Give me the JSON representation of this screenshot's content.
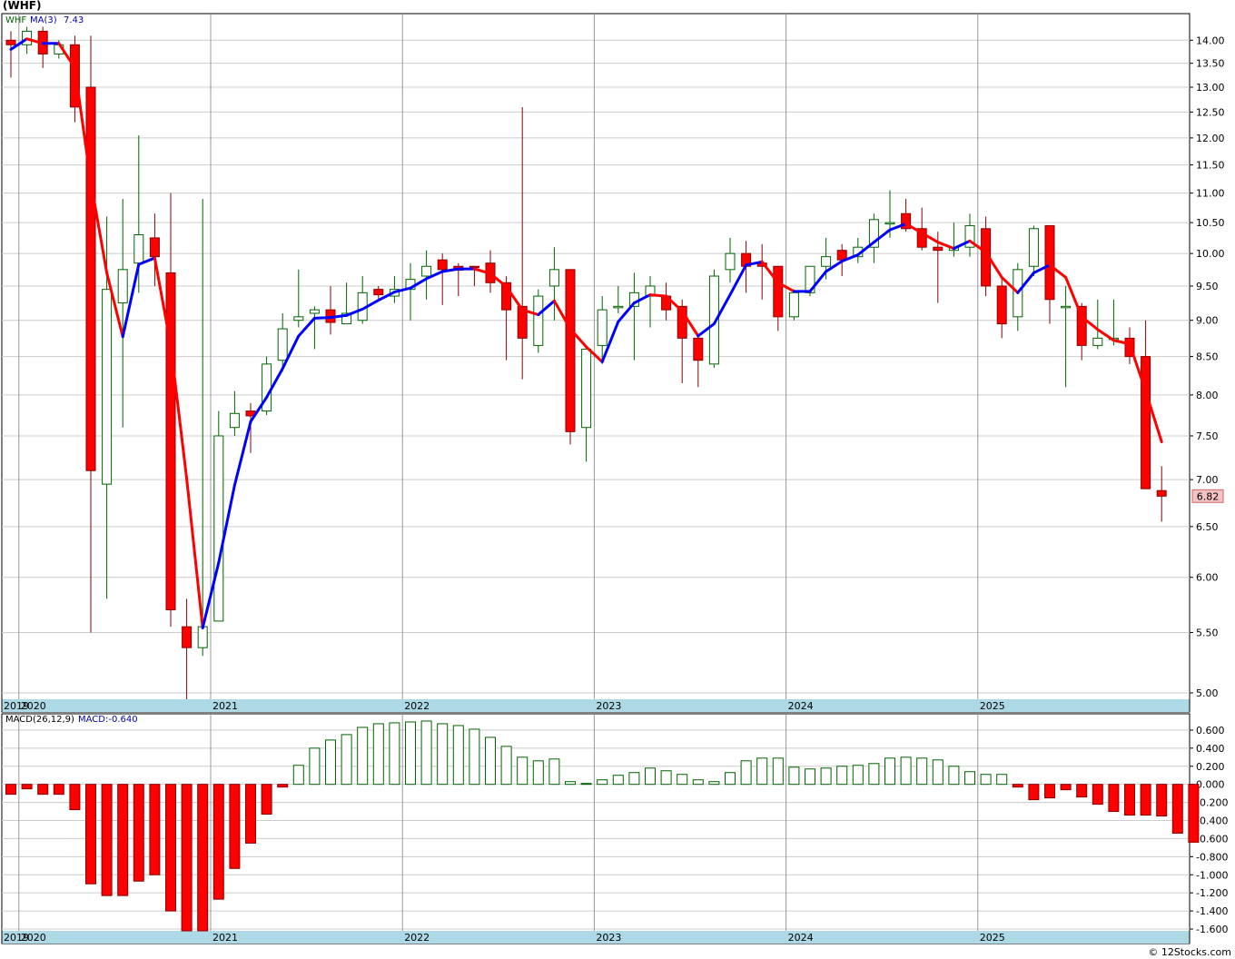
{
  "symbol_header": "(WHF)",
  "credit": "© 12Stocks.com",
  "colors": {
    "up": "#006400",
    "down": "#ff0000",
    "ma_up": "#0000ff",
    "ma_down": "#ff0000",
    "axis_band": "#add8e6",
    "grid": "#cccccc",
    "grid_v": "#999999"
  },
  "chart_data": {
    "type": "candlestick",
    "title": "(WHF)",
    "frequency": "monthly",
    "price_scale": "log",
    "price_ylim": [
      4.95,
      14.6
    ],
    "price_ticks": [
      "14.00",
      "13.50",
      "13.00",
      "12.50",
      "12.00",
      "11.50",
      "11.00",
      "10.50",
      "10.00",
      "9.50",
      "9.00",
      "8.50",
      "8.00",
      "7.50",
      "7.00",
      "6.50",
      "6.00",
      "5.50",
      "5.00"
    ],
    "year_labels": [
      "2019",
      "2020",
      "2021",
      "2022",
      "2023",
      "2024",
      "2025"
    ],
    "legend": {
      "symbol": "WHF",
      "ma_label": "MA(3)",
      "ma_value": "7.43"
    },
    "last_price_label": "6.82",
    "start": "2019-12",
    "ohlc": [
      [
        14.0,
        14.2,
        13.2,
        13.9
      ],
      [
        13.9,
        14.3,
        13.7,
        14.2
      ],
      [
        14.2,
        14.3,
        13.4,
        13.7
      ],
      [
        13.7,
        14.0,
        13.6,
        13.9
      ],
      [
        13.9,
        14.1,
        12.3,
        12.6
      ],
      [
        13.0,
        14.1,
        5.5,
        7.1
      ],
      [
        6.95,
        10.6,
        5.8,
        9.45
      ],
      [
        9.25,
        10.9,
        7.6,
        9.75
      ],
      [
        9.85,
        12.05,
        9.4,
        10.3
      ],
      [
        10.25,
        10.65,
        9.5,
        9.95
      ],
      [
        9.7,
        11.0,
        5.55,
        5.7
      ],
      [
        5.55,
        5.8,
        4.95,
        5.37
      ],
      [
        5.37,
        10.9,
        5.3,
        5.55
      ],
      [
        5.6,
        7.8,
        5.6,
        7.5
      ],
      [
        7.6,
        8.05,
        7.5,
        7.77
      ],
      [
        7.8,
        7.9,
        7.3,
        7.74
      ],
      [
        7.8,
        8.5,
        7.75,
        8.4
      ],
      [
        8.45,
        9.1,
        8.3,
        8.88
      ],
      [
        9.0,
        9.75,
        8.9,
        9.05
      ],
      [
        9.1,
        9.2,
        8.6,
        9.15
      ],
      [
        9.15,
        9.5,
        8.8,
        8.97
      ],
      [
        8.95,
        9.55,
        8.95,
        9.1
      ],
      [
        9.0,
        9.65,
        8.95,
        9.4
      ],
      [
        9.45,
        9.5,
        9.3,
        9.37
      ],
      [
        9.35,
        9.65,
        9.25,
        9.45
      ],
      [
        9.45,
        9.85,
        9.0,
        9.6
      ],
      [
        9.65,
        10.05,
        9.3,
        9.8
      ],
      [
        9.9,
        10.0,
        9.22,
        9.75
      ],
      [
        9.8,
        9.85,
        9.35,
        9.74
      ],
      [
        9.8,
        9.8,
        9.5,
        9.78
      ],
      [
        9.85,
        10.05,
        9.4,
        9.55
      ],
      [
        9.55,
        9.65,
        8.45,
        9.15
      ],
      [
        9.2,
        12.6,
        8.2,
        8.75
      ],
      [
        8.65,
        9.45,
        8.55,
        9.35
      ],
      [
        9.5,
        10.1,
        9.0,
        9.75
      ],
      [
        9.75,
        9.75,
        7.4,
        7.55
      ],
      [
        7.6,
        8.45,
        7.2,
        8.6
      ],
      [
        8.65,
        9.35,
        8.4,
        9.15
      ],
      [
        9.18,
        9.5,
        9.1,
        9.2
      ],
      [
        9.2,
        9.7,
        8.45,
        9.4
      ],
      [
        9.35,
        9.65,
        8.9,
        9.5
      ],
      [
        9.35,
        9.55,
        9.0,
        9.15
      ],
      [
        9.2,
        9.3,
        8.15,
        8.75
      ],
      [
        8.75,
        8.8,
        8.1,
        8.45
      ],
      [
        8.4,
        9.75,
        8.35,
        9.65
      ],
      [
        9.75,
        10.25,
        9.55,
        10.0
      ],
      [
        10.0,
        10.2,
        9.4,
        9.8
      ],
      [
        9.85,
        10.15,
        9.3,
        9.8
      ],
      [
        9.8,
        9.8,
        8.85,
        9.05
      ],
      [
        9.05,
        9.45,
        9.0,
        9.4
      ],
      [
        9.4,
        9.8,
        9.35,
        9.8
      ],
      [
        9.8,
        10.25,
        9.6,
        9.95
      ],
      [
        10.05,
        10.15,
        9.65,
        9.9
      ],
      [
        9.95,
        10.25,
        9.85,
        10.1
      ],
      [
        10.1,
        10.65,
        9.85,
        10.55
      ],
      [
        10.5,
        11.05,
        10.25,
        10.5
      ],
      [
        10.65,
        10.9,
        10.35,
        10.4
      ],
      [
        10.4,
        10.75,
        10.05,
        10.1
      ],
      [
        10.1,
        10.35,
        9.25,
        10.05
      ],
      [
        10.05,
        10.5,
        9.95,
        10.1
      ],
      [
        10.1,
        10.65,
        9.95,
        10.45
      ],
      [
        10.4,
        10.6,
        9.35,
        9.5
      ],
      [
        9.5,
        9.65,
        8.75,
        8.95
      ],
      [
        9.05,
        9.85,
        8.85,
        9.75
      ],
      [
        9.8,
        10.45,
        9.65,
        10.4
      ],
      [
        10.45,
        10.45,
        8.95,
        9.3
      ],
      [
        9.2,
        9.5,
        8.1,
        9.2
      ],
      [
        9.2,
        9.25,
        8.45,
        8.65
      ],
      [
        8.65,
        9.3,
        8.6,
        8.75
      ],
      [
        8.75,
        9.3,
        8.65,
        8.75
      ],
      [
        8.75,
        8.9,
        8.4,
        8.5
      ],
      [
        8.5,
        9.0,
        6.9,
        6.9
      ],
      [
        6.88,
        7.15,
        6.55,
        6.82
      ]
    ],
    "ma3": [
      13.8,
      14.03,
      13.93,
      13.93,
      13.4,
      11.2,
      9.7,
      8.77,
      9.83,
      9.93,
      8.65,
      7.01,
      5.54,
      6.14,
      6.94,
      7.67,
      7.97,
      8.34,
      8.78,
      9.03,
      9.04,
      9.07,
      9.16,
      9.29,
      9.41,
      9.47,
      9.61,
      9.72,
      9.76,
      9.76,
      9.69,
      9.49,
      9.15,
      9.08,
      9.28,
      8.88,
      8.63,
      8.43,
      8.98,
      9.25,
      9.37,
      9.35,
      9.13,
      8.78,
      8.95,
      9.37,
      9.82,
      9.87,
      9.55,
      9.42,
      9.42,
      9.72,
      9.88,
      9.98,
      10.18,
      10.38,
      10.48,
      10.33,
      10.18,
      10.08,
      10.2,
      10.02,
      9.63,
      9.4,
      9.7,
      9.82,
      9.63,
      9.05,
      8.87,
      8.72,
      8.67,
      8.05,
      7.43
    ],
    "macd_label": "MACD(26,12,9)",
    "macd_value_label": "MACD:-0.640",
    "macd_ylim": [
      -1.62,
      0.78
    ],
    "macd_ticks": [
      "0.600",
      "0.400",
      "0.200",
      "0.000",
      "-0.200",
      "-0.400",
      "-0.600",
      "-0.800",
      "-1.000",
      "-1.200",
      "-1.400",
      "-1.600"
    ],
    "macd": [
      -0.11,
      -0.05,
      -0.11,
      -0.11,
      -0.28,
      -1.1,
      -1.23,
      -1.23,
      -1.07,
      -1.0,
      -1.4,
      -1.62,
      -1.62,
      -1.27,
      -0.93,
      -0.65,
      -0.33,
      -0.03,
      0.21,
      0.4,
      0.49,
      0.55,
      0.63,
      0.67,
      0.68,
      0.69,
      0.7,
      0.67,
      0.65,
      0.61,
      0.52,
      0.42,
      0.3,
      0.26,
      0.28,
      0.03,
      0.01,
      0.05,
      0.1,
      0.13,
      0.18,
      0.15,
      0.11,
      0.05,
      0.03,
      0.13,
      0.26,
      0.29,
      0.29,
      0.19,
      0.17,
      0.18,
      0.2,
      0.21,
      0.23,
      0.29,
      0.3,
      0.29,
      0.27,
      0.2,
      0.14,
      0.11,
      0.11,
      -0.03,
      -0.17,
      -0.15,
      -0.06,
      -0.14,
      -0.22,
      -0.3,
      -0.34,
      -0.34,
      -0.35,
      -0.54,
      -0.64
    ]
  }
}
